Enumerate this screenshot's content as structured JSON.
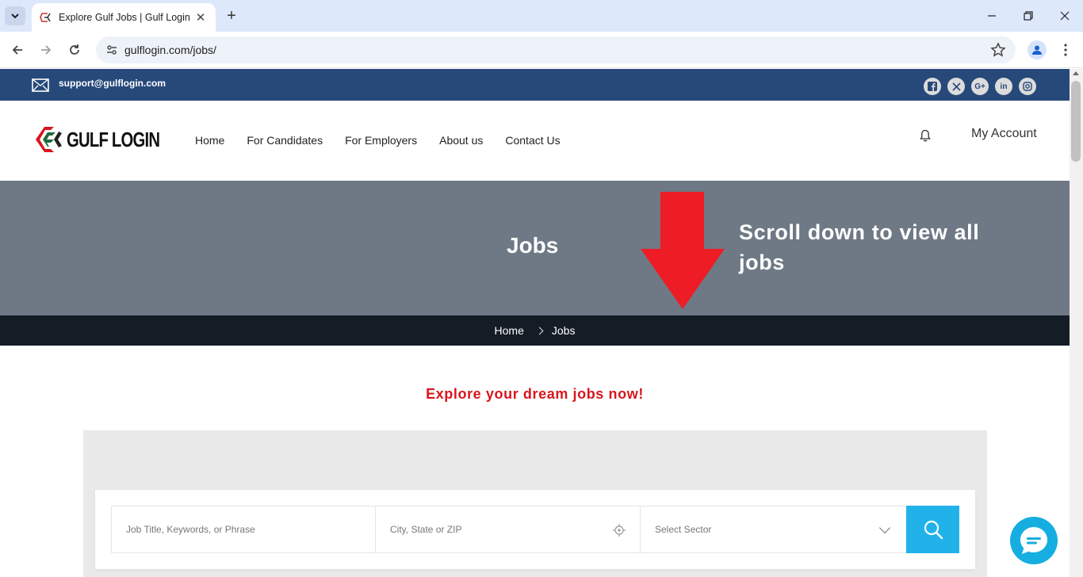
{
  "browser": {
    "tab_title": "Explore Gulf Jobs | Gulf Login",
    "url": "gulflogin.com/jobs/"
  },
  "topbar": {
    "email": "support@gulflogin.com",
    "socials": [
      "facebook-icon",
      "x-icon",
      "google-plus-icon",
      "linkedin-icon",
      "instagram-icon"
    ]
  },
  "header": {
    "logo_text": "GULF LOGIN",
    "nav": [
      "Home",
      "For Candidates",
      "For Employers",
      "About us",
      "Contact Us"
    ],
    "account": "My Account"
  },
  "hero": {
    "title": "Jobs",
    "annotation": "Scroll down to view all jobs"
  },
  "breadcrumb": {
    "home": "Home",
    "current": "Jobs"
  },
  "main": {
    "headline": "Explore your dream jobs now!"
  },
  "search": {
    "keyword_placeholder": "Job Title, Keywords, or Phrase",
    "location_placeholder": "City, State or ZIP",
    "sector_placeholder": "Select Sector"
  },
  "colors": {
    "topbar": "#27497a",
    "hero": "#6e7985",
    "breadcrumb_bar": "#141c26",
    "accent_red": "#d8161d",
    "search_button": "#22b2ea"
  }
}
